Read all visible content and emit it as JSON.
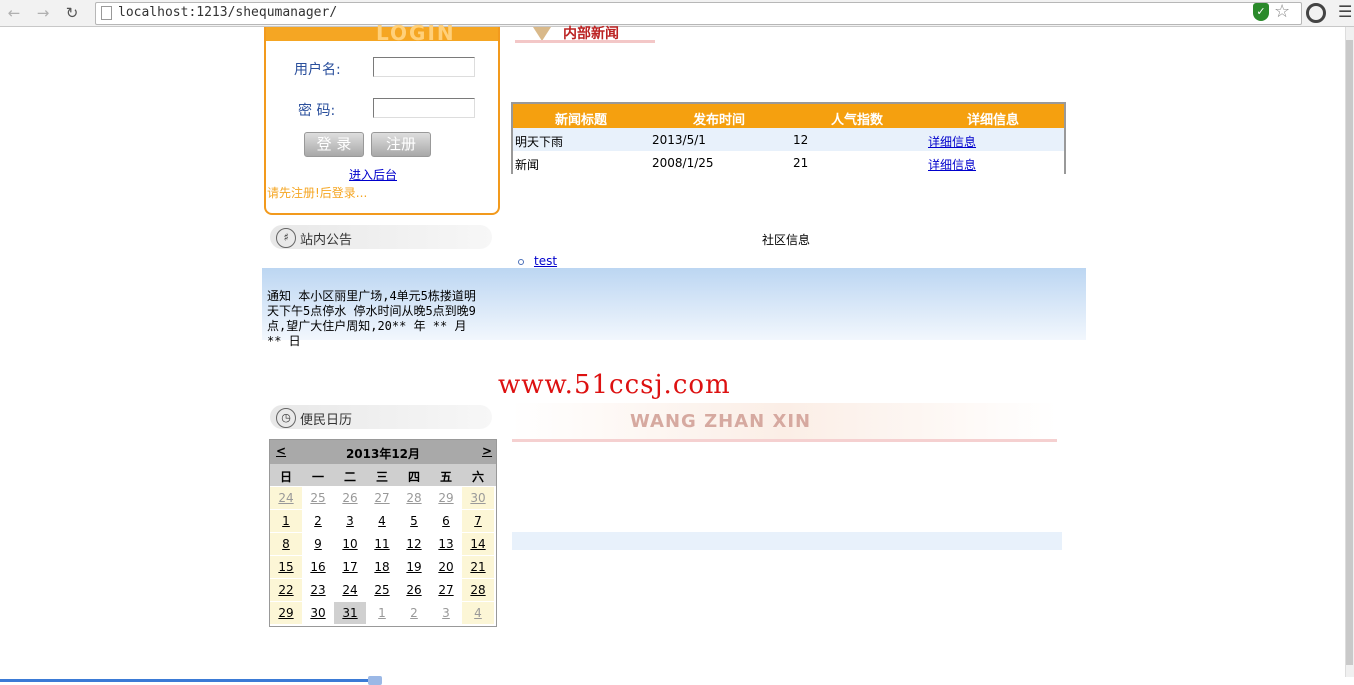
{
  "browser": {
    "url": "localhost:1213/shequmanager/"
  },
  "login": {
    "banner_text": "LOGIN",
    "username_label": "用户名:",
    "password_label": "密 码:",
    "login_button": "登 录",
    "register_button": "注册",
    "admin_link": "进入后台",
    "warning": "请先注册!后登录..."
  },
  "announcement": {
    "title": "站内公告",
    "text": "通知 本小区丽里广场,4单元5栋搂道明天下午5点停水 停水时间从晚5点到晚9点,望广大住户周知,20** 年 ** 月 ** 日"
  },
  "calendar": {
    "title": "便民日历",
    "prev": "<",
    "next": ">",
    "month_label": "2013年12月",
    "weekdays": [
      "日",
      "一",
      "二",
      "三",
      "四",
      "五",
      "六"
    ],
    "days": [
      [
        "24",
        "25",
        "26",
        "27",
        "28",
        "29",
        "30"
      ],
      [
        "1",
        "2",
        "3",
        "4",
        "5",
        "6",
        "7"
      ],
      [
        "8",
        "9",
        "10",
        "11",
        "12",
        "13",
        "14"
      ],
      [
        "15",
        "16",
        "17",
        "18",
        "19",
        "20",
        "21"
      ],
      [
        "22",
        "23",
        "24",
        "25",
        "26",
        "27",
        "28"
      ],
      [
        "29",
        "30",
        "31",
        "1",
        "2",
        "3",
        "4"
      ]
    ]
  },
  "news": {
    "section_title": "内部新闻",
    "headers": [
      "新闻标题",
      "发布时间",
      "人气指数",
      "详细信息"
    ],
    "rows": [
      {
        "title": "明天下雨",
        "date": "2013/5/1",
        "hits": "12",
        "detail": "详细信息"
      },
      {
        "title": "新闻",
        "date": "2008/1/25",
        "hits": "21",
        "detail": "详细信息"
      }
    ]
  },
  "community": {
    "title": "社区信息",
    "items": [
      "test"
    ]
  },
  "watermark": "www.51ccsj.com",
  "banner_text": "WANG ZHAN XIN"
}
